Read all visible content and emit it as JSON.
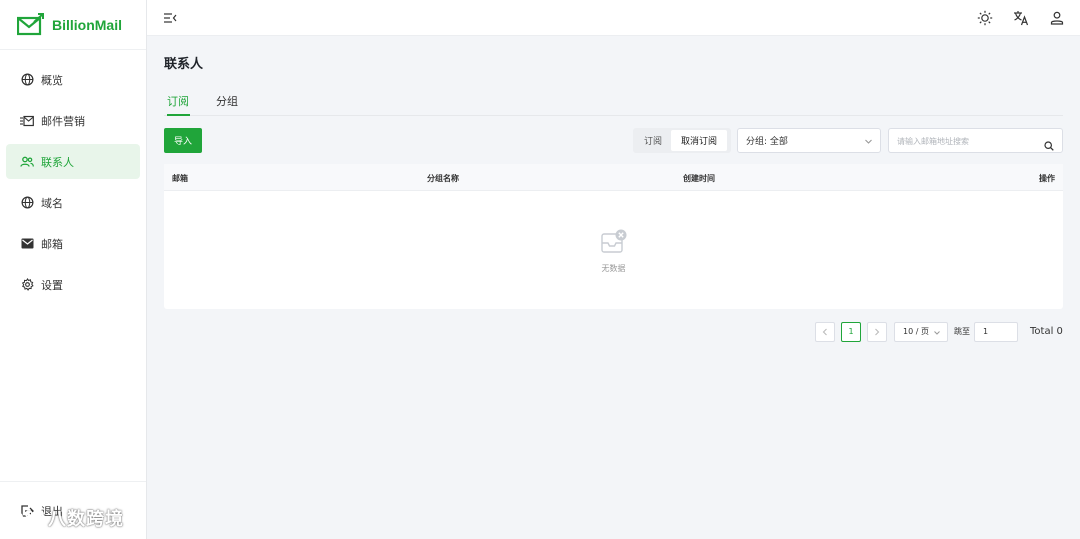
{
  "app": {
    "name": "BillionMail",
    "brand_color": "#20a53a"
  },
  "sidebar": {
    "items": [
      {
        "label": "概览",
        "icon": "globe-icon"
      },
      {
        "label": "邮件营销",
        "icon": "mail-list-icon"
      },
      {
        "label": "联系人",
        "icon": "users-icon",
        "active": true
      },
      {
        "label": "域名",
        "icon": "globe-icon"
      },
      {
        "label": "邮箱",
        "icon": "envelope-icon"
      },
      {
        "label": "设置",
        "icon": "gear-icon"
      }
    ],
    "logout_label": "退出"
  },
  "page": {
    "title": "联系人",
    "tabs": [
      {
        "label": "订阅",
        "active": true
      },
      {
        "label": "分组",
        "active": false
      }
    ]
  },
  "toolbar": {
    "import_label": "导入",
    "segment": {
      "option1": "订阅",
      "option2": "取消订阅",
      "selected": "取消订阅"
    },
    "group_select": "分组: 全部",
    "search_placeholder": "请输入邮箱地址搜索"
  },
  "table": {
    "columns": [
      "邮箱",
      "分组名称",
      "创建时间",
      "操作"
    ],
    "rows": [],
    "empty_text": "无数据"
  },
  "pagination": {
    "current_page": "1",
    "page_size": "10 / 页",
    "jump_label": "跳至",
    "jump_value": "1",
    "total": "Total 0"
  },
  "watermark": "八数跨境"
}
